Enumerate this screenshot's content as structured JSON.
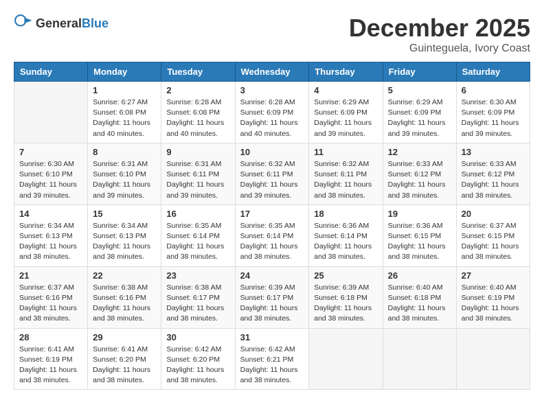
{
  "logo": {
    "text_general": "General",
    "text_blue": "Blue"
  },
  "title": {
    "month": "December 2025",
    "location": "Guinteguela, Ivory Coast"
  },
  "weekdays": [
    "Sunday",
    "Monday",
    "Tuesday",
    "Wednesday",
    "Thursday",
    "Friday",
    "Saturday"
  ],
  "weeks": [
    [
      {
        "day": "",
        "sunrise": "",
        "sunset": "",
        "daylight": ""
      },
      {
        "day": "1",
        "sunrise": "Sunrise: 6:27 AM",
        "sunset": "Sunset: 6:08 PM",
        "daylight": "Daylight: 11 hours and 40 minutes."
      },
      {
        "day": "2",
        "sunrise": "Sunrise: 6:28 AM",
        "sunset": "Sunset: 6:08 PM",
        "daylight": "Daylight: 11 hours and 40 minutes."
      },
      {
        "day": "3",
        "sunrise": "Sunrise: 6:28 AM",
        "sunset": "Sunset: 6:09 PM",
        "daylight": "Daylight: 11 hours and 40 minutes."
      },
      {
        "day": "4",
        "sunrise": "Sunrise: 6:29 AM",
        "sunset": "Sunset: 6:09 PM",
        "daylight": "Daylight: 11 hours and 39 minutes."
      },
      {
        "day": "5",
        "sunrise": "Sunrise: 6:29 AM",
        "sunset": "Sunset: 6:09 PM",
        "daylight": "Daylight: 11 hours and 39 minutes."
      },
      {
        "day": "6",
        "sunrise": "Sunrise: 6:30 AM",
        "sunset": "Sunset: 6:09 PM",
        "daylight": "Daylight: 11 hours and 39 minutes."
      }
    ],
    [
      {
        "day": "7",
        "sunrise": "Sunrise: 6:30 AM",
        "sunset": "Sunset: 6:10 PM",
        "daylight": "Daylight: 11 hours and 39 minutes."
      },
      {
        "day": "8",
        "sunrise": "Sunrise: 6:31 AM",
        "sunset": "Sunset: 6:10 PM",
        "daylight": "Daylight: 11 hours and 39 minutes."
      },
      {
        "day": "9",
        "sunrise": "Sunrise: 6:31 AM",
        "sunset": "Sunset: 6:11 PM",
        "daylight": "Daylight: 11 hours and 39 minutes."
      },
      {
        "day": "10",
        "sunrise": "Sunrise: 6:32 AM",
        "sunset": "Sunset: 6:11 PM",
        "daylight": "Daylight: 11 hours and 39 minutes."
      },
      {
        "day": "11",
        "sunrise": "Sunrise: 6:32 AM",
        "sunset": "Sunset: 6:11 PM",
        "daylight": "Daylight: 11 hours and 38 minutes."
      },
      {
        "day": "12",
        "sunrise": "Sunrise: 6:33 AM",
        "sunset": "Sunset: 6:12 PM",
        "daylight": "Daylight: 11 hours and 38 minutes."
      },
      {
        "day": "13",
        "sunrise": "Sunrise: 6:33 AM",
        "sunset": "Sunset: 6:12 PM",
        "daylight": "Daylight: 11 hours and 38 minutes."
      }
    ],
    [
      {
        "day": "14",
        "sunrise": "Sunrise: 6:34 AM",
        "sunset": "Sunset: 6:13 PM",
        "daylight": "Daylight: 11 hours and 38 minutes."
      },
      {
        "day": "15",
        "sunrise": "Sunrise: 6:34 AM",
        "sunset": "Sunset: 6:13 PM",
        "daylight": "Daylight: 11 hours and 38 minutes."
      },
      {
        "day": "16",
        "sunrise": "Sunrise: 6:35 AM",
        "sunset": "Sunset: 6:14 PM",
        "daylight": "Daylight: 11 hours and 38 minutes."
      },
      {
        "day": "17",
        "sunrise": "Sunrise: 6:35 AM",
        "sunset": "Sunset: 6:14 PM",
        "daylight": "Daylight: 11 hours and 38 minutes."
      },
      {
        "day": "18",
        "sunrise": "Sunrise: 6:36 AM",
        "sunset": "Sunset: 6:14 PM",
        "daylight": "Daylight: 11 hours and 38 minutes."
      },
      {
        "day": "19",
        "sunrise": "Sunrise: 6:36 AM",
        "sunset": "Sunset: 6:15 PM",
        "daylight": "Daylight: 11 hours and 38 minutes."
      },
      {
        "day": "20",
        "sunrise": "Sunrise: 6:37 AM",
        "sunset": "Sunset: 6:15 PM",
        "daylight": "Daylight: 11 hours and 38 minutes."
      }
    ],
    [
      {
        "day": "21",
        "sunrise": "Sunrise: 6:37 AM",
        "sunset": "Sunset: 6:16 PM",
        "daylight": "Daylight: 11 hours and 38 minutes."
      },
      {
        "day": "22",
        "sunrise": "Sunrise: 6:38 AM",
        "sunset": "Sunset: 6:16 PM",
        "daylight": "Daylight: 11 hours and 38 minutes."
      },
      {
        "day": "23",
        "sunrise": "Sunrise: 6:38 AM",
        "sunset": "Sunset: 6:17 PM",
        "daylight": "Daylight: 11 hours and 38 minutes."
      },
      {
        "day": "24",
        "sunrise": "Sunrise: 6:39 AM",
        "sunset": "Sunset: 6:17 PM",
        "daylight": "Daylight: 11 hours and 38 minutes."
      },
      {
        "day": "25",
        "sunrise": "Sunrise: 6:39 AM",
        "sunset": "Sunset: 6:18 PM",
        "daylight": "Daylight: 11 hours and 38 minutes."
      },
      {
        "day": "26",
        "sunrise": "Sunrise: 6:40 AM",
        "sunset": "Sunset: 6:18 PM",
        "daylight": "Daylight: 11 hours and 38 minutes."
      },
      {
        "day": "27",
        "sunrise": "Sunrise: 6:40 AM",
        "sunset": "Sunset: 6:19 PM",
        "daylight": "Daylight: 11 hours and 38 minutes."
      }
    ],
    [
      {
        "day": "28",
        "sunrise": "Sunrise: 6:41 AM",
        "sunset": "Sunset: 6:19 PM",
        "daylight": "Daylight: 11 hours and 38 minutes."
      },
      {
        "day": "29",
        "sunrise": "Sunrise: 6:41 AM",
        "sunset": "Sunset: 6:20 PM",
        "daylight": "Daylight: 11 hours and 38 minutes."
      },
      {
        "day": "30",
        "sunrise": "Sunrise: 6:42 AM",
        "sunset": "Sunset: 6:20 PM",
        "daylight": "Daylight: 11 hours and 38 minutes."
      },
      {
        "day": "31",
        "sunrise": "Sunrise: 6:42 AM",
        "sunset": "Sunset: 6:21 PM",
        "daylight": "Daylight: 11 hours and 38 minutes."
      },
      {
        "day": "",
        "sunrise": "",
        "sunset": "",
        "daylight": ""
      },
      {
        "day": "",
        "sunrise": "",
        "sunset": "",
        "daylight": ""
      },
      {
        "day": "",
        "sunrise": "",
        "sunset": "",
        "daylight": ""
      }
    ]
  ]
}
